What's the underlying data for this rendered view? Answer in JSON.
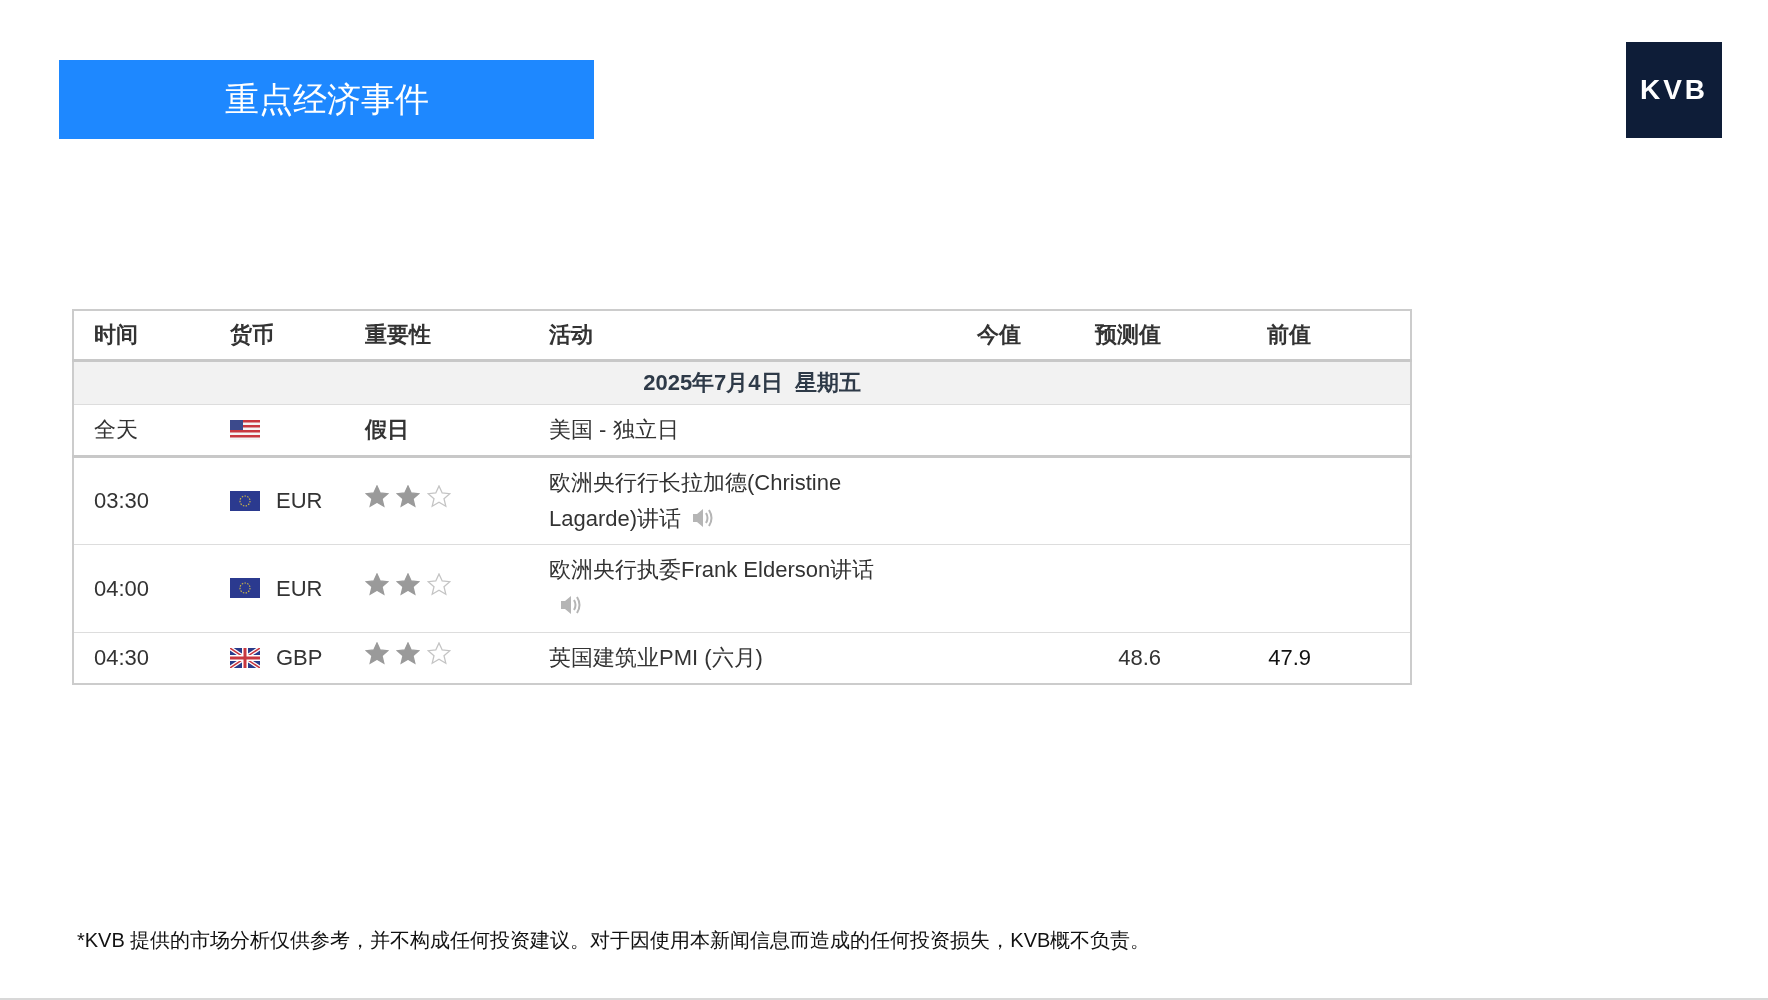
{
  "title": "重点经济事件",
  "logo": "KVB",
  "table": {
    "columns": [
      "时间",
      "货币",
      "重要性",
      "活动",
      "今值",
      "预测值",
      "前值"
    ],
    "date": "2025年7月4日  星期五",
    "rows": [
      {
        "kind": "holiday",
        "time": "全天",
        "flag": {
          "kind": "us"
        },
        "importance": "假日",
        "event": "美国 - 独立日",
        "audio": false
      },
      {
        "kind": "event",
        "time": "03:30",
        "flag": {
          "kind": "eu"
        },
        "currency": "EUR",
        "stars": 2,
        "event": "欧洲央行行长拉加德(Christine Lagarde)讲话",
        "audio": true
      },
      {
        "kind": "event",
        "time": "04:00",
        "flag": {
          "kind": "eu"
        },
        "currency": "EUR",
        "stars": 2,
        "event": "欧洲央行执委Frank Elderson讲话",
        "audio": true
      },
      {
        "kind": "event",
        "time": "04:30",
        "flag": {
          "kind": "gb"
        },
        "currency": "GBP",
        "stars": 2,
        "event": "英国建筑业PMI (六月)",
        "audio": false,
        "forecast": "48.6",
        "previous": "47.9"
      }
    ]
  },
  "disclaimer": "*KVB 提供的市场分析仅供参考，并不构成任何投资建议。对于因使用本新闻信息而造成的任何投资损失，KVB概不负责。"
}
